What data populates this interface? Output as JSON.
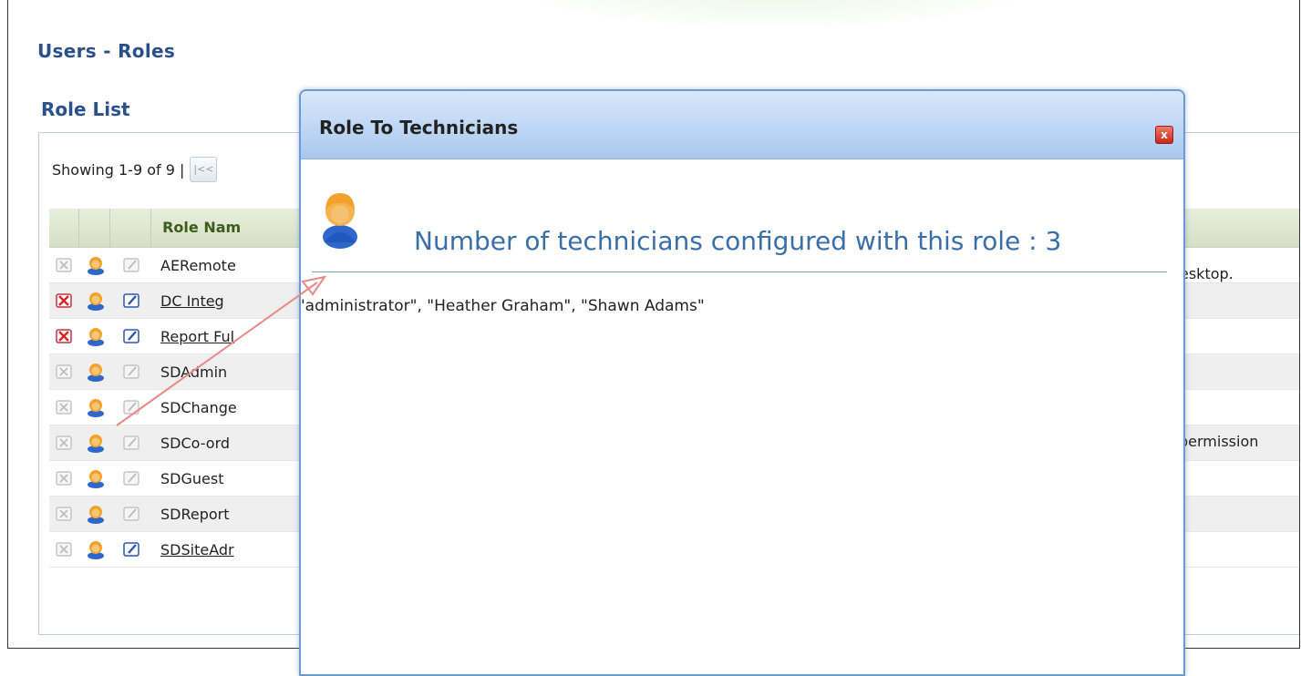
{
  "page": {
    "title": "Users - Roles",
    "section_title": "Role List",
    "showing_text": "Showing 1-9 of 9 |",
    "first_page_label": "|<<",
    "column_header": "Role Nam"
  },
  "roles": [
    {
      "name": "AERemote",
      "link": false,
      "deletable": false,
      "editable": false
    },
    {
      "name": "DC Integ",
      "link": true,
      "deletable": true,
      "editable": true
    },
    {
      "name": "Report Ful",
      "link": true,
      "deletable": true,
      "editable": true
    },
    {
      "name": "SDAdmin",
      "link": false,
      "deletable": false,
      "editable": false
    },
    {
      "name": "SDChange",
      "link": false,
      "deletable": false,
      "editable": false
    },
    {
      "name": "SDCo-ord",
      "link": false,
      "deletable": false,
      "editable": false
    },
    {
      "name": "SDGuest",
      "link": false,
      "deletable": false,
      "editable": false
    },
    {
      "name": "SDReport",
      "link": false,
      "deletable": false,
      "editable": false
    },
    {
      "name": "SDSiteAdr",
      "link": true,
      "deletable": false,
      "editable": true
    }
  ],
  "descriptions": {
    "row1": "esktop.",
    "row5": "permission"
  },
  "modal": {
    "title": "Role To Technicians",
    "close_label": "x",
    "heading": "Number of technicians configured with this role : 3",
    "technicians_text": "'administrator\", \"Heather Graham\", \"Shawn Adams\""
  },
  "colors": {
    "title_blue": "#2a4f8a",
    "modal_border": "#6b9bd6",
    "heading_blue": "#3a6ea8",
    "annotation_arrow": "#e8898a"
  }
}
